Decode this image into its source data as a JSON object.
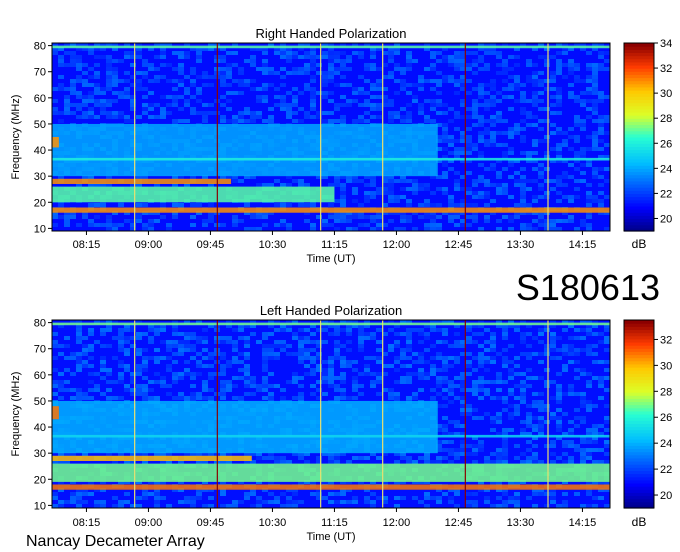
{
  "chart_data": [
    {
      "type": "heatmap",
      "title": "Right Handed Polarization",
      "xlabel": "Time (UT)",
      "ylabel": "Frequency (MHz)",
      "xlim": [
        "07:50",
        "14:35"
      ],
      "ylim": [
        9,
        81
      ],
      "x_ticks": [
        "08:15",
        "09:00",
        "09:45",
        "10:30",
        "11:15",
        "12:00",
        "12:45",
        "13:30",
        "14:15"
      ],
      "y_ticks": [
        10,
        20,
        30,
        40,
        50,
        60,
        70,
        80
      ],
      "colorbar": {
        "label": "dB",
        "ticks": [
          20,
          22,
          24,
          26,
          28,
          30,
          32,
          34
        ],
        "range": [
          19,
          34
        ]
      },
      "background_level": 21,
      "bands": [
        {
          "freq": [
            27,
            29
          ],
          "level": 31,
          "until": "10:00"
        },
        {
          "freq": [
            20,
            26
          ],
          "level": 27,
          "until": "11:15"
        },
        {
          "freq": [
            16,
            18
          ],
          "level": 31,
          "until": "14:35"
        },
        {
          "freq": [
            30,
            50
          ],
          "level": 24,
          "until": "12:30"
        },
        {
          "freq": [
            36,
            37
          ],
          "level": 26,
          "until": "14:35"
        },
        {
          "freq": [
            79,
            80
          ],
          "level": 27,
          "until": "14:35"
        },
        {
          "freq": [
            41,
            45
          ],
          "level": 31,
          "until": "07:55"
        }
      ],
      "vertical_lines": [
        {
          "time": "08:50",
          "color": "#e8e070"
        },
        {
          "time": "09:50",
          "color": "#8b0000"
        },
        {
          "time": "11:05",
          "color": "#e8e070"
        },
        {
          "time": "11:50",
          "color": "#e8e070"
        },
        {
          "time": "12:50",
          "color": "#8b0000"
        },
        {
          "time": "13:50",
          "color": "#e8e070"
        }
      ]
    },
    {
      "type": "heatmap",
      "title": "Left Handed Polarization",
      "xlabel": "Time (UT)",
      "ylabel": "Frequency (MHz)",
      "xlim": [
        "07:50",
        "14:35"
      ],
      "ylim": [
        9,
        81
      ],
      "x_ticks": [
        "08:15",
        "09:00",
        "09:45",
        "10:30",
        "11:15",
        "12:00",
        "12:45",
        "13:30",
        "14:15"
      ],
      "y_ticks": [
        10,
        20,
        30,
        40,
        50,
        60,
        70,
        80
      ],
      "colorbar": {
        "label": "dB",
        "ticks": [
          20,
          22,
          24,
          26,
          28,
          30,
          32
        ],
        "range": [
          19,
          33.5
        ]
      },
      "background_level": 21,
      "bands": [
        {
          "freq": [
            27,
            29
          ],
          "level": 30,
          "until": "10:15"
        },
        {
          "freq": [
            19,
            26
          ],
          "level": 27,
          "until": "14:35"
        },
        {
          "freq": [
            16,
            18
          ],
          "level": 31,
          "until": "14:35"
        },
        {
          "freq": [
            30,
            50
          ],
          "level": 24,
          "until": "12:30"
        },
        {
          "freq": [
            36,
            37
          ],
          "level": 25,
          "until": "14:35"
        },
        {
          "freq": [
            79,
            80
          ],
          "level": 27,
          "until": "14:35"
        },
        {
          "freq": [
            43,
            48
          ],
          "level": 31,
          "until": "07:55"
        }
      ],
      "vertical_lines": [
        {
          "time": "08:50",
          "color": "#e8e070"
        },
        {
          "time": "09:50",
          "color": "#8b0000"
        },
        {
          "time": "11:05",
          "color": "#e8e070"
        },
        {
          "time": "11:50",
          "color": "#e8e070"
        },
        {
          "time": "12:50",
          "color": "#8b0000"
        },
        {
          "time": "13:50",
          "color": "#e8e070"
        }
      ]
    }
  ],
  "labels": {
    "date_code": "S180613",
    "instrument": "Nancay Decameter Array"
  },
  "colors": {
    "axes": "#000000",
    "background": "#ffffff"
  }
}
